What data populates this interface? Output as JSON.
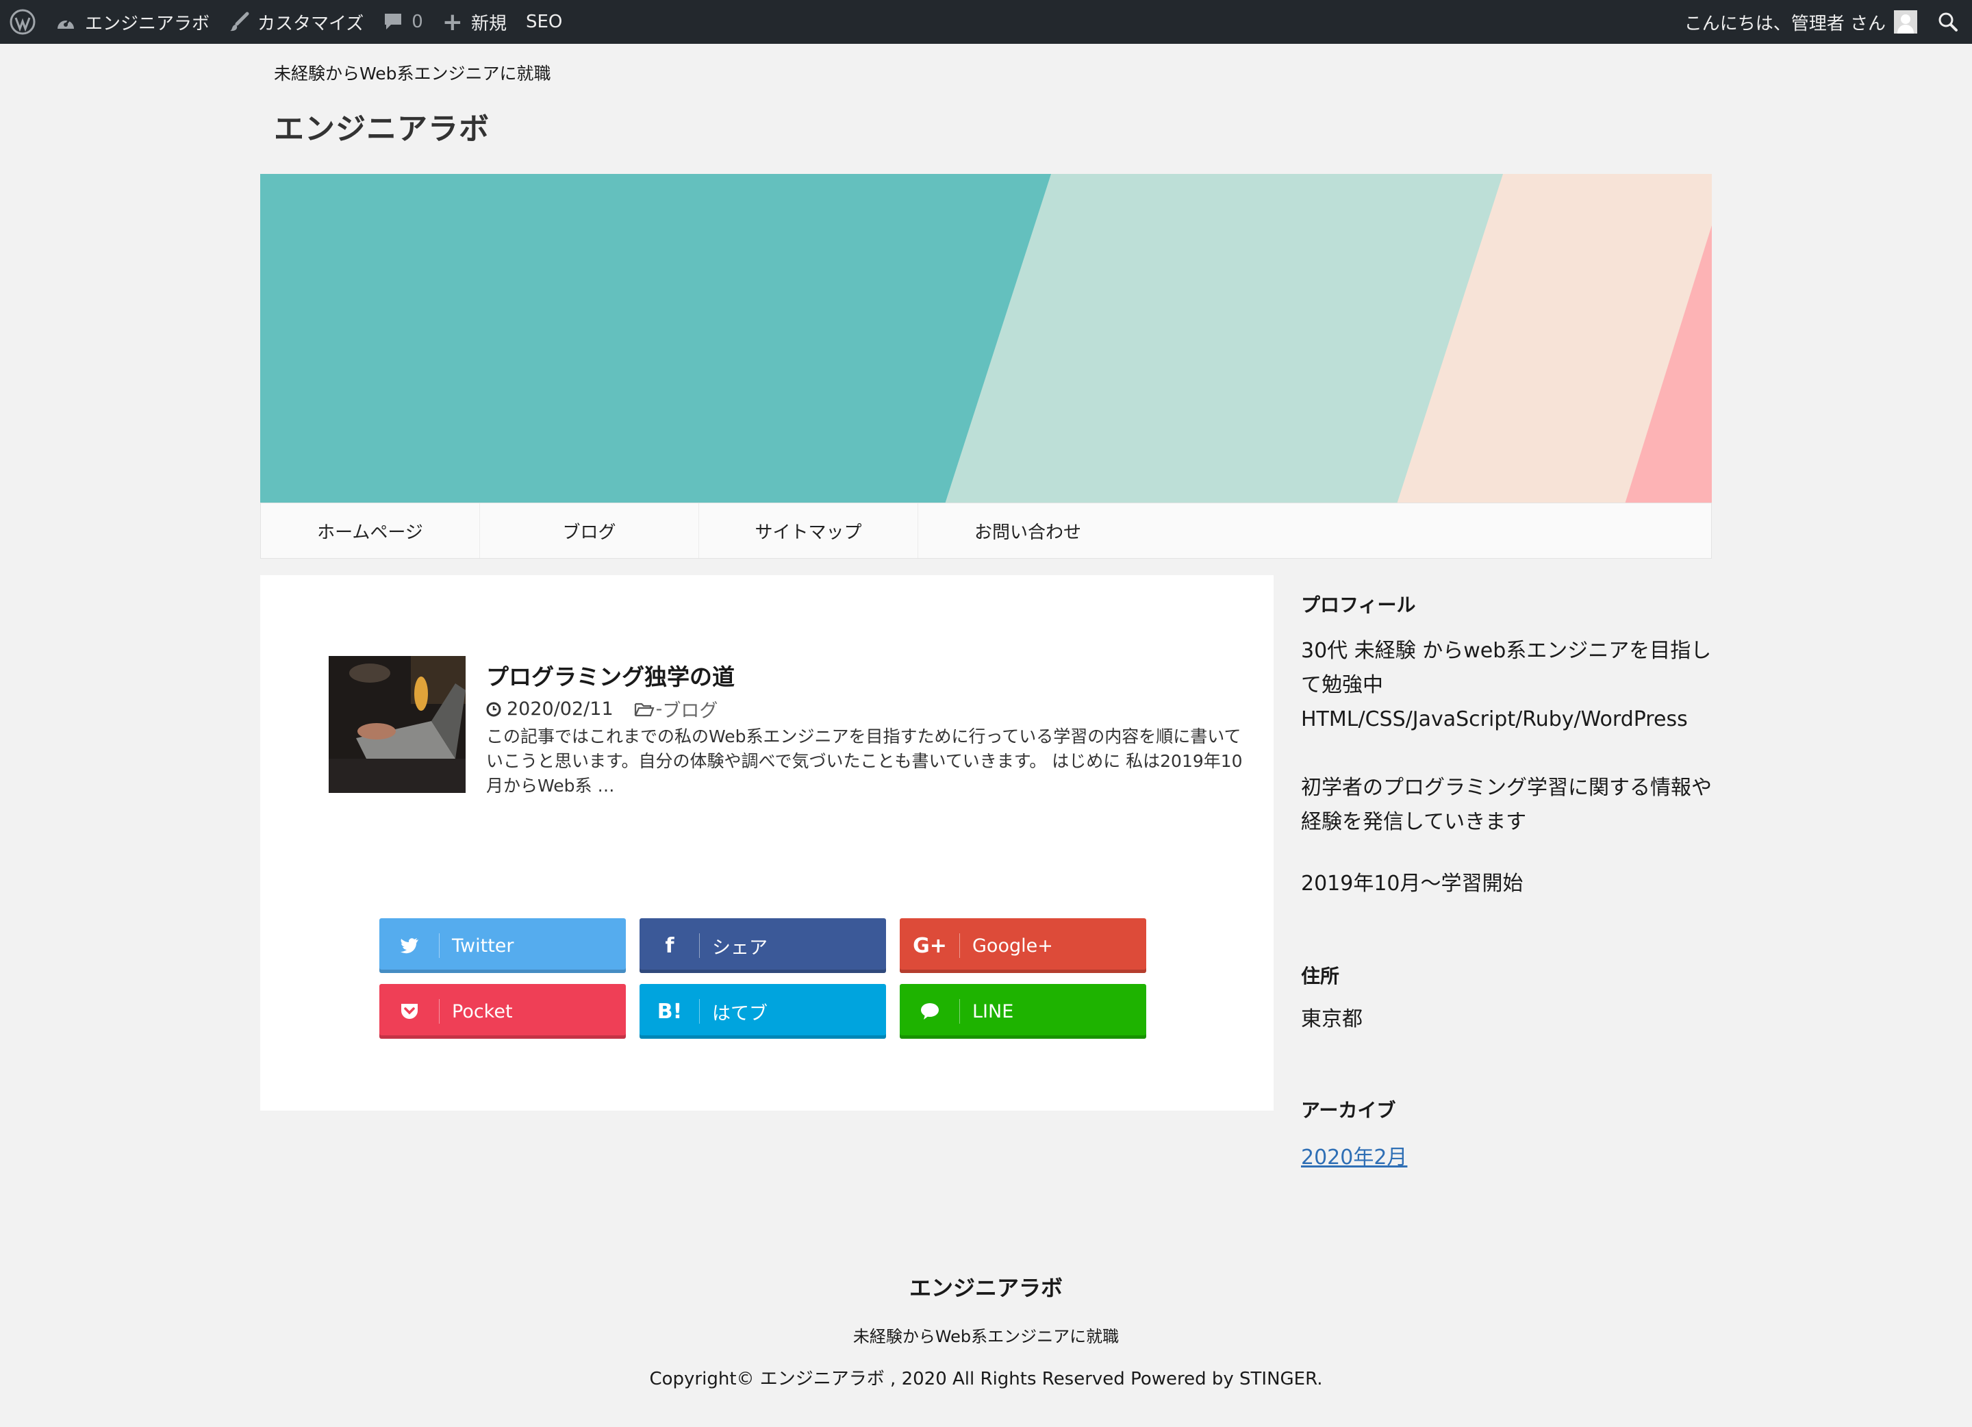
{
  "adminbar": {
    "site_name": "エンジニアラボ",
    "customize": "カスタマイズ",
    "comments_count": "0",
    "new_label": "新規",
    "seo_label": "SEO",
    "greeting": "こんにちは、管理者 さん"
  },
  "header": {
    "tagline": "未経験からWeb系エンジニアに就職",
    "title": "エンジニアラボ"
  },
  "hero": {
    "colors": [
      "#64c0be",
      "#bddfd7",
      "#f7e3d7",
      "#fdb3b5"
    ]
  },
  "nav": {
    "items": [
      {
        "label": "ホームページ"
      },
      {
        "label": "ブログ"
      },
      {
        "label": "サイトマップ"
      },
      {
        "label": "お問い合わせ"
      }
    ]
  },
  "post": {
    "title": "プログラミング独学の道",
    "date": "2020/02/11",
    "category": "ブログ",
    "excerpt": "この記事ではこれまでの私のWeb系エンジニアを目指すために行っている学習の内容を順に書いていこうと思います。自分の体験や調べで気づいたことも書いていきます。 はじめに 私は2019年10月からWeb系 …"
  },
  "share": {
    "twitter": {
      "label": "Twitter",
      "color": "#55acee"
    },
    "facebook": {
      "label": "シェア",
      "color": "#3b5998"
    },
    "google": {
      "label": "Google+",
      "color": "#dd4b39"
    },
    "pocket": {
      "label": "Pocket",
      "color": "#ef3f56"
    },
    "hatena": {
      "label": "はてブ",
      "color": "#00a4de"
    },
    "line": {
      "label": "LINE",
      "color": "#1eb300"
    }
  },
  "sidebar": {
    "profile_heading": "プロフィール",
    "profile_line1": "30代 未経験 からweb系エンジニアを目指して勉強中",
    "profile_line2": "HTML/CSS/JavaScript/Ruby/WordPress",
    "profile_line3": "初学者のプログラミング学習に関する情報や経験を発信していきます",
    "profile_line4": "2019年10月〜学習開始",
    "address_heading": "住所",
    "address": "東京都",
    "archive_heading": "アーカイブ",
    "archive_link": "2020年2月"
  },
  "footer": {
    "title": "エンジニアラボ",
    "tagline": "未経験からWeb系エンジニアに就職",
    "copyright": "Copyright© エンジニアラボ , 2020 All Rights Reserved Powered by STINGER."
  }
}
